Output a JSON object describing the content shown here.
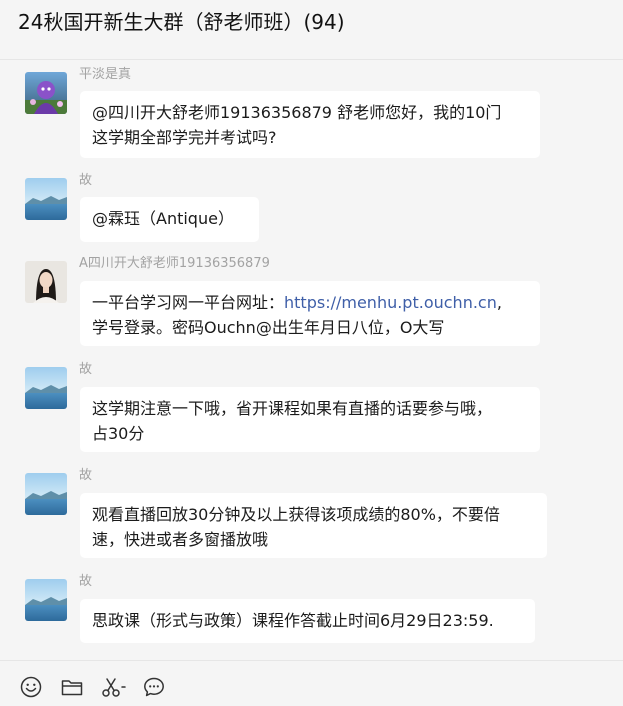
{
  "header": {
    "title": "24秋国开新生大群（舒老师班）(94)"
  },
  "messages": [
    {
      "sender": "平淡是真",
      "avatar": "purple-character-avatar",
      "lines": [
        "@四川开大舒老师19136356879 舒老师您好，我的10门",
        "这学期全部学完并考试吗?"
      ]
    },
    {
      "sender": "故",
      "avatar": "lake-landscape-avatar",
      "lines": [
        "@霖珏（Antique）"
      ]
    },
    {
      "sender": "A四川开大舒老师19136356879",
      "avatar": "teacher-portrait-avatar",
      "line1_prefix": "一平台学习网一平台网址：",
      "line1_link": "https://menhu.pt.ouchn.cn",
      "line1_suffix": ",",
      "line2": "学号登录。密码Ouchn@出生年月日八位，O大写"
    },
    {
      "sender": "故",
      "avatar": "lake-landscape-avatar",
      "lines": [
        "这学期注意一下哦，省开课程如果有直播的话要参与哦，",
        "占30分"
      ]
    },
    {
      "sender": "故",
      "avatar": "lake-landscape-avatar",
      "lines": [
        "观看直播回放30分钟及以上获得该项成绩的80%，不要倍",
        "速，快进或者多窗播放哦"
      ]
    },
    {
      "sender": "故",
      "avatar": "lake-landscape-avatar",
      "lines": [
        "思政课（形式与政策）课程作答截止时间6月29日23:59."
      ]
    }
  ],
  "toolbar": {
    "icons": [
      "emoji-icon",
      "folder-icon",
      "scissors-icon",
      "chat-bubble-icon"
    ]
  }
}
